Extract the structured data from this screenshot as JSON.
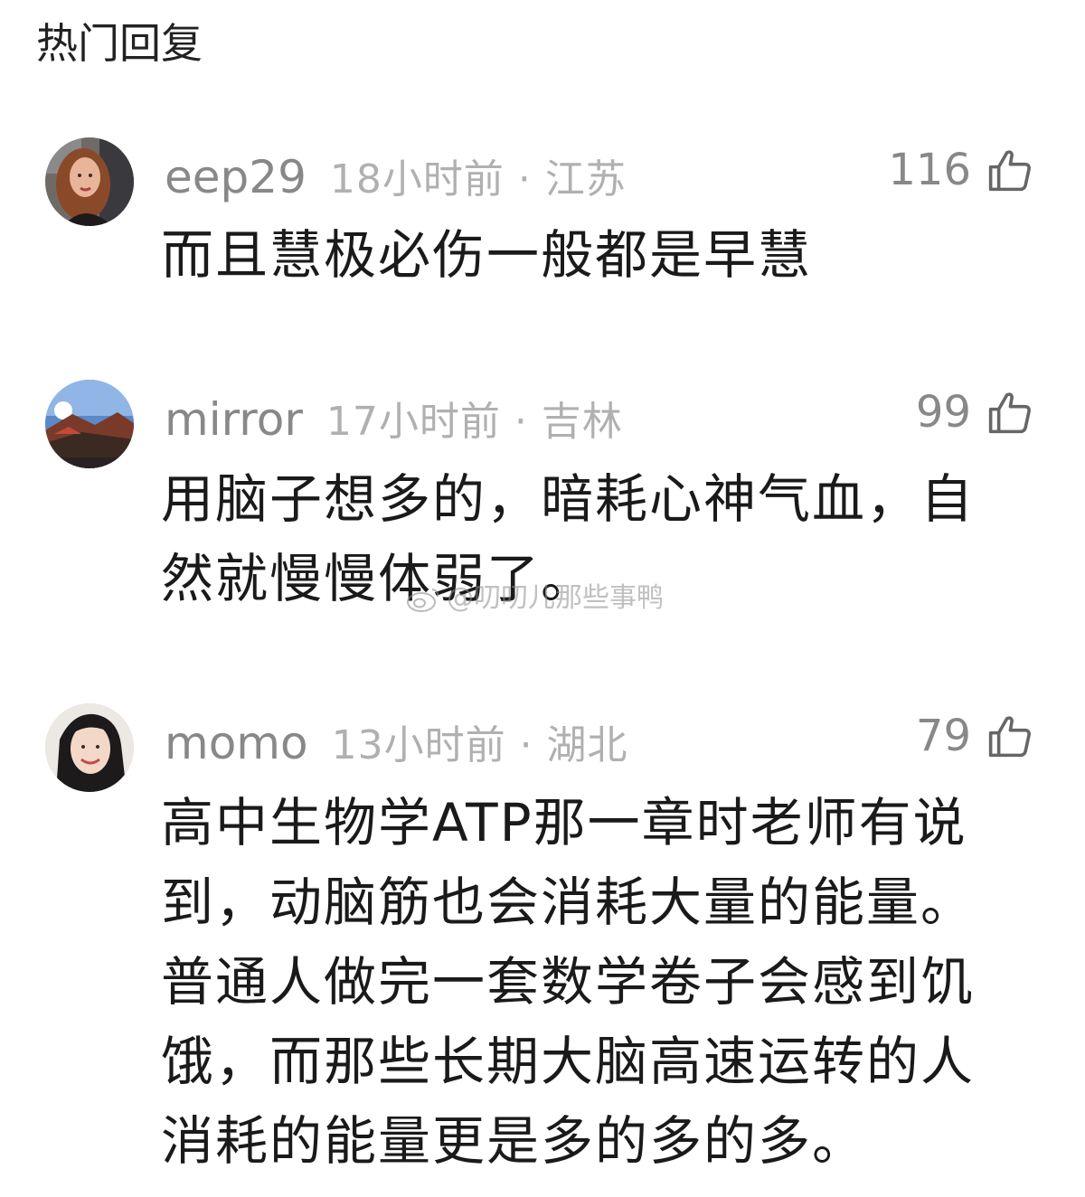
{
  "section": {
    "title": "热门回复"
  },
  "comments": [
    {
      "username": "eep29",
      "time_location": "18小时前 · 江苏",
      "likes": "116",
      "content": "而且慧极必伤一般都是早慧",
      "avatar_icon": "portrait-woman-avatar"
    },
    {
      "username": "mirror",
      "time_location": "17小时前 · 吉林",
      "likes": "99",
      "content": "用脑子想多的，暗耗心神气血，自然就慢慢体弱了。",
      "avatar_icon": "landscape-avatar"
    },
    {
      "username": "momo",
      "time_location": "13小时前 · 湖北",
      "likes": "79",
      "content": "高中生物学ATP那一章时老师有说到，动脑筋也会消耗大量的能量。普通人做完一套数学卷子会感到饥饿，而那些长期大脑高速运转的人消耗的能量更是多的多的多。",
      "avatar_icon": "portrait-girl-avatar"
    }
  ],
  "watermark": {
    "text": "@叨叨儿那些事鸭",
    "icon": "weibo-icon"
  },
  "colors": {
    "username": "#888888",
    "meta": "#b0b0b0",
    "content": "#1a1a1a",
    "background": "#ffffff"
  }
}
